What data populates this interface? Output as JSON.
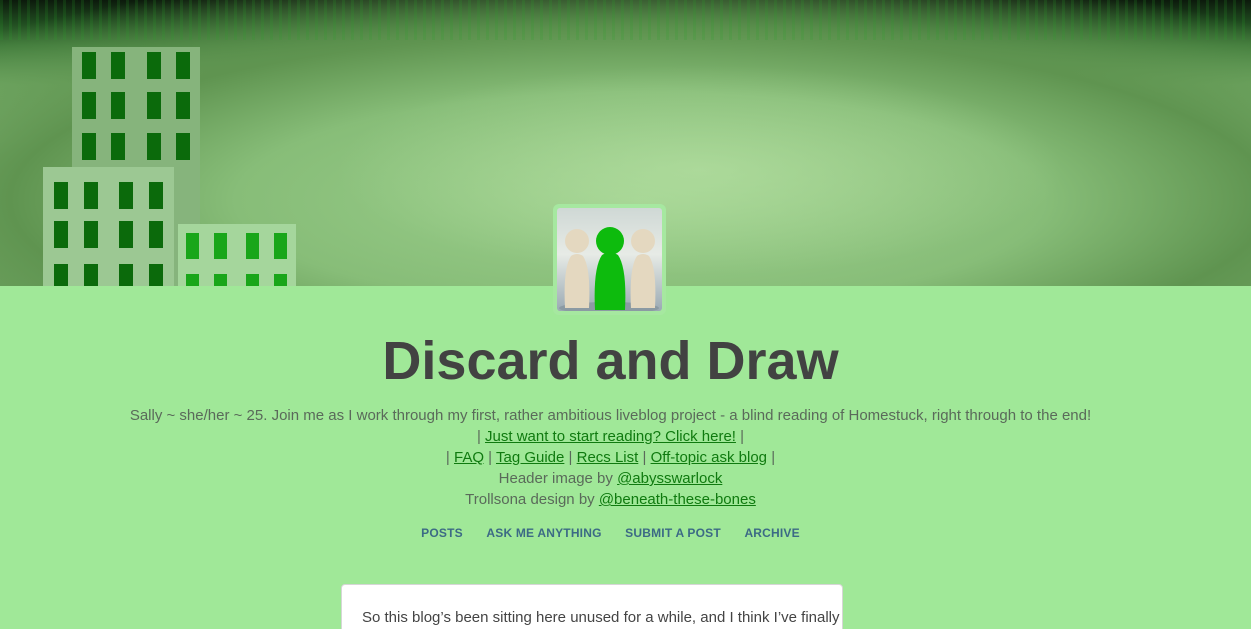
{
  "blog": {
    "title": "Discard and Draw",
    "description_line1": "Sally ~ she/her ~ 25. Join me as I work through my first, rather ambitious liveblog project - a blind reading of Homestuck, right through to the end!",
    "start_link": "Just want to start reading? Click here!",
    "links": [
      "FAQ",
      "Tag Guide",
      "Recs List",
      "Off-topic ask blog"
    ],
    "header_credit_prefix": "Header image by ",
    "header_credit_link": "@abysswarlock",
    "trollsona_prefix": "Trollsona design by ",
    "trollsona_link": "@beneath-these-bones",
    "separator": "|"
  },
  "nav": {
    "posts": "POSTS",
    "ask": "ASK ME ANYTHING",
    "submit": "SUBMIT A POST",
    "archive": "ARCHIVE"
  },
  "post": {
    "text": "So this blog’s been sitting here unused for a while, and I think I’ve finally"
  },
  "colors": {
    "background": "#a0e898",
    "title": "#424242",
    "link": "#0f7a0f",
    "nav": "#3c6a85"
  }
}
